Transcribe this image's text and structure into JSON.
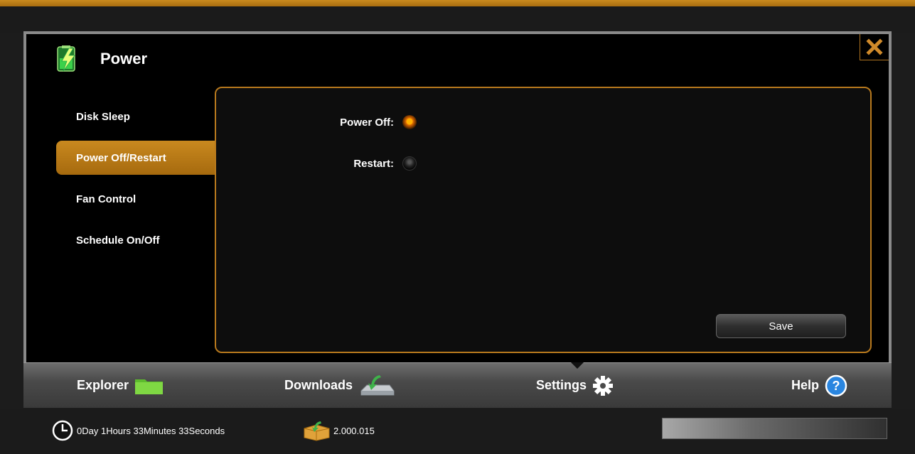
{
  "dialog": {
    "title": "Power"
  },
  "sidebar": {
    "items": [
      {
        "label": "Disk Sleep",
        "active": false
      },
      {
        "label": "Power Off/Restart",
        "active": true
      },
      {
        "label": "Fan Control",
        "active": false
      },
      {
        "label": "Schedule On/Off",
        "active": false
      }
    ]
  },
  "options": {
    "power_off_label": "Power Off:",
    "restart_label": "Restart:",
    "selected": "Power Off"
  },
  "buttons": {
    "save_label": "Save"
  },
  "tabs": {
    "explorer": "Explorer",
    "downloads": "Downloads",
    "settings": "Settings",
    "help": "Help"
  },
  "status": {
    "uptime": "0Day 1Hours 33Minutes 33Seconds",
    "version": "2.000.015"
  },
  "colors": {
    "accent": "#c0801a",
    "background": "#000000"
  },
  "icons": {
    "close": "close-icon",
    "power": "battery-power-icon",
    "explorer": "folder-icon",
    "downloads": "download-drive-icon",
    "settings": "gear-icon",
    "help": "help-icon",
    "uptime": "clock-icon",
    "version": "package-icon"
  }
}
